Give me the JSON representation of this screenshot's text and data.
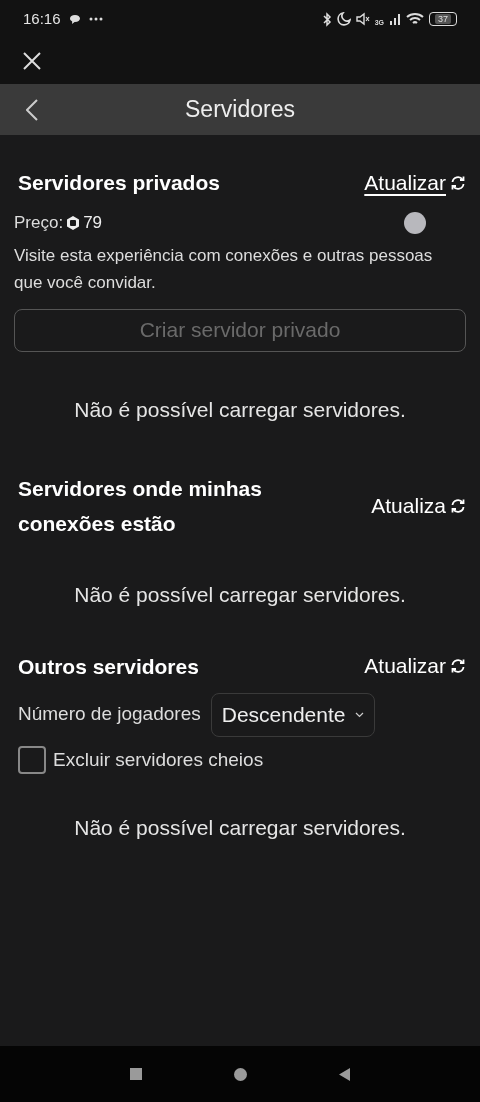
{
  "status_bar": {
    "time": "16:16",
    "network": "3G",
    "battery": "37"
  },
  "header": {
    "title": "Servidores"
  },
  "private": {
    "title": "Servidores privados",
    "refresh": {
      "label": "Atualizar",
      "underlined": true
    },
    "price_label": "Preço:",
    "price": "79",
    "description": "Visite esta experiência com conexões e outras pessoas que você convidar.",
    "create_button": {
      "label": "Criar servidor privado",
      "disabled": true
    },
    "message": "Não é possível carregar servidores."
  },
  "friends": {
    "title": "Servidores onde minhas conexões estão",
    "refresh": {
      "label": "Atualiza",
      "underlined": false
    },
    "message": "Não é possível carregar servidores."
  },
  "others": {
    "title": "Outros servidores",
    "refresh": {
      "label": "Atualizar",
      "underlined": false
    },
    "sort_label": "Número de jogadores",
    "sort_value": "Descendente",
    "exclude_full": {
      "label": "Excluir servidores cheios",
      "checked": false
    },
    "message": "Não é possível carregar servidores."
  }
}
